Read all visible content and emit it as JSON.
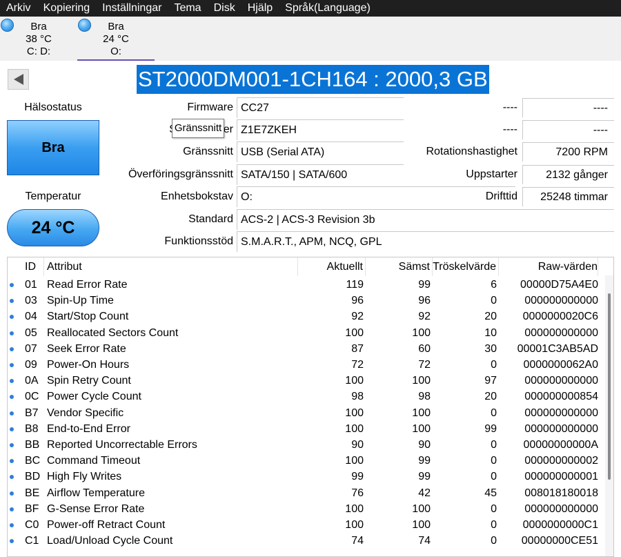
{
  "menu": [
    "Arkiv",
    "Kopiering",
    "Inställningar",
    "Tema",
    "Disk",
    "Hjälp",
    "Språk(Language)"
  ],
  "drives": [
    {
      "status": "Bra",
      "temp": "38 °C",
      "letters": "C: D:"
    },
    {
      "status": "Bra",
      "temp": "24 °C",
      "letters": "O:"
    }
  ],
  "title": "ST2000DM001-1CH164 : 2000,3 GB",
  "health": {
    "label": "Hälsostatus",
    "value": "Bra"
  },
  "temperature": {
    "label": "Temperatur",
    "value": "24 °C"
  },
  "tooltip": "Gränssnitt",
  "info": {
    "firmware": {
      "label": "Firmware",
      "value": "CC27"
    },
    "serial": {
      "label_prefix": "S",
      "label_suffix": "er",
      "value": "Z1E7ZKEH"
    },
    "interface": {
      "label": "Gränssnitt",
      "value": "USB (Serial ATA)"
    },
    "transfer": {
      "label": "Överföringsgränssnitt",
      "value": "SATA/150 | SATA/600"
    },
    "drive_letter": {
      "label": "Enhetsbokstav",
      "value": "O:"
    },
    "standard": {
      "label": "Standard",
      "value": "ACS-2 | ACS-3 Revision 3b"
    },
    "features": {
      "label": "Funktionsstöd",
      "value": "S.M.A.R.T., APM, NCQ, GPL"
    }
  },
  "right_info": {
    "r1": {
      "label": "----",
      "value": "----"
    },
    "r2": {
      "label": "----",
      "value": "----"
    },
    "rotation": {
      "label": "Rotationshastighet",
      "value": "7200 RPM"
    },
    "power_on_count": {
      "label": "Uppstarter",
      "value": "2132 gånger"
    },
    "power_on_hours": {
      "label": "Drifttid",
      "value": "25248 timmar"
    }
  },
  "table": {
    "headers": {
      "id": "ID",
      "attribute": "Attribut",
      "current": "Aktuellt",
      "worst": "Sämst",
      "threshold": "Tröskelvärde",
      "raw": "Raw-värden"
    },
    "rows": [
      {
        "id": "01",
        "name": "Read Error Rate",
        "cur": "119",
        "worst": "99",
        "thr": "6",
        "raw": "00000D75A4E0"
      },
      {
        "id": "03",
        "name": "Spin-Up Time",
        "cur": "96",
        "worst": "96",
        "thr": "0",
        "raw": "000000000000"
      },
      {
        "id": "04",
        "name": "Start/Stop Count",
        "cur": "92",
        "worst": "92",
        "thr": "20",
        "raw": "0000000020C6"
      },
      {
        "id": "05",
        "name": "Reallocated Sectors Count",
        "cur": "100",
        "worst": "100",
        "thr": "10",
        "raw": "000000000000"
      },
      {
        "id": "07",
        "name": "Seek Error Rate",
        "cur": "87",
        "worst": "60",
        "thr": "30",
        "raw": "00001C3AB5AD"
      },
      {
        "id": "09",
        "name": "Power-On Hours",
        "cur": "72",
        "worst": "72",
        "thr": "0",
        "raw": "0000000062A0"
      },
      {
        "id": "0A",
        "name": "Spin Retry Count",
        "cur": "100",
        "worst": "100",
        "thr": "97",
        "raw": "000000000000"
      },
      {
        "id": "0C",
        "name": "Power Cycle Count",
        "cur": "98",
        "worst": "98",
        "thr": "20",
        "raw": "000000000854"
      },
      {
        "id": "B7",
        "name": "Vendor Specific",
        "cur": "100",
        "worst": "100",
        "thr": "0",
        "raw": "000000000000"
      },
      {
        "id": "B8",
        "name": "End-to-End Error",
        "cur": "100",
        "worst": "100",
        "thr": "99",
        "raw": "000000000000"
      },
      {
        "id": "BB",
        "name": "Reported Uncorrectable Errors",
        "cur": "90",
        "worst": "90",
        "thr": "0",
        "raw": "00000000000A"
      },
      {
        "id": "BC",
        "name": "Command Timeout",
        "cur": "100",
        "worst": "99",
        "thr": "0",
        "raw": "000000000002"
      },
      {
        "id": "BD",
        "name": "High Fly Writes",
        "cur": "99",
        "worst": "99",
        "thr": "0",
        "raw": "000000000001"
      },
      {
        "id": "BE",
        "name": "Airflow Temperature",
        "cur": "76",
        "worst": "42",
        "thr": "45",
        "raw": "008018180018"
      },
      {
        "id": "BF",
        "name": "G-Sense Error Rate",
        "cur": "100",
        "worst": "100",
        "thr": "0",
        "raw": "000000000000"
      },
      {
        "id": "C0",
        "name": "Power-off Retract Count",
        "cur": "100",
        "worst": "100",
        "thr": "0",
        "raw": "0000000000C1"
      },
      {
        "id": "C1",
        "name": "Load/Unload Cycle Count",
        "cur": "74",
        "worst": "74",
        "thr": "0",
        "raw": "00000000CE51"
      }
    ]
  }
}
